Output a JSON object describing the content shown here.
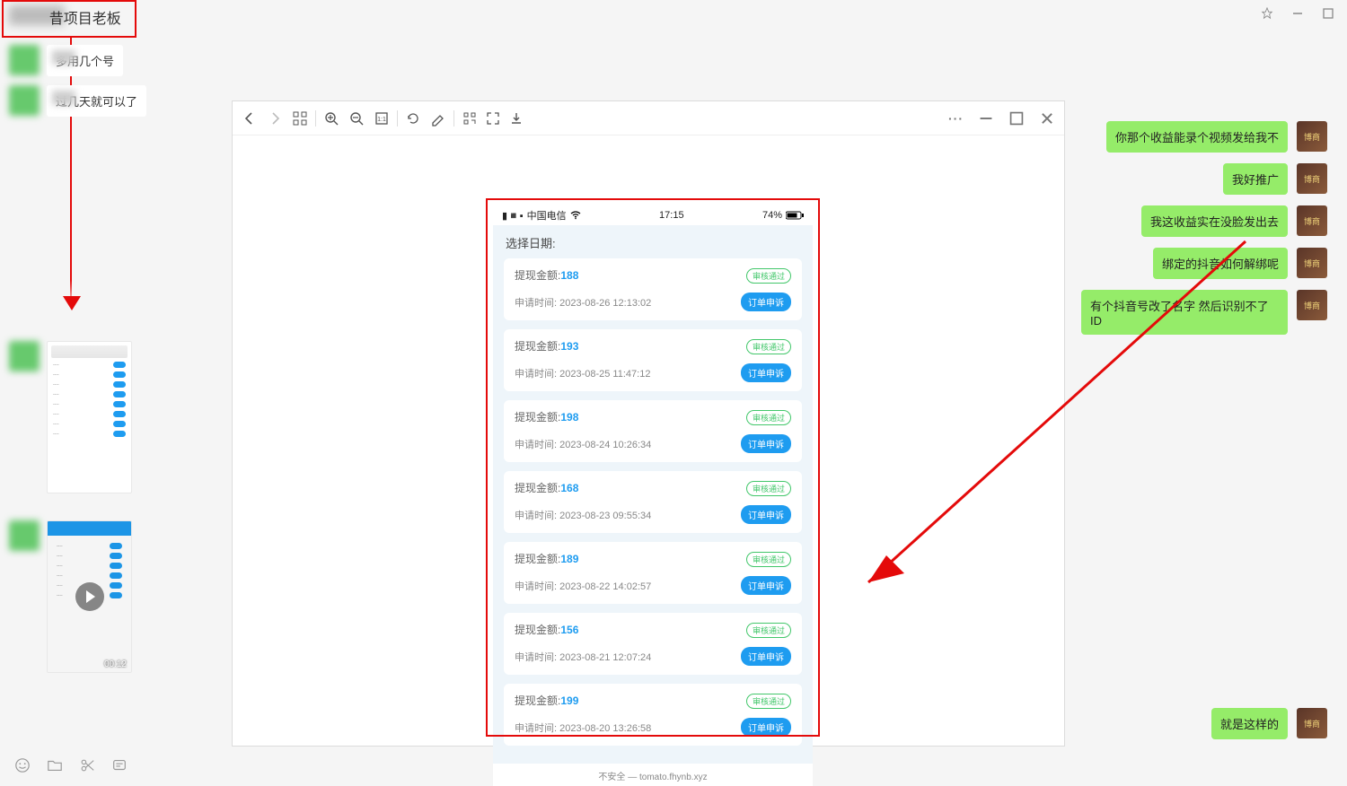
{
  "window": {
    "title_suffix": "昔项目老板",
    "pin_icon": "pin",
    "minimize_icon": "minimize",
    "maximize_icon": "maximize"
  },
  "left_messages": [
    {
      "text": "多用几个号"
    },
    {
      "text": "过几天就可以了"
    }
  ],
  "video_duration": "00:12",
  "right_messages": [
    "你那个收益能录个视频发给我不",
    "我好推广",
    "我这收益实在没脸发出去",
    "绑定的抖音如何解绑呢",
    "有个抖音号改了名字 然后识别不了ID"
  ],
  "right_bottom_message": "就是这样的",
  "viewer": {
    "more": "···"
  },
  "phone": {
    "carrier": "中国电信",
    "time": "17:15",
    "battery": "74%",
    "section_title": "选择日期:",
    "amount_label": "提现金额:",
    "apply_label_prefix": "申请时间: ",
    "status_text": "审核通过",
    "action_text": "订单申诉",
    "footer_text": "不安全 — tomato.fhynb.xyz",
    "records": [
      {
        "amount": "188",
        "time": "2023-08-26 12:13:02"
      },
      {
        "amount": "193",
        "time": "2023-08-25 11:47:12"
      },
      {
        "amount": "198",
        "time": "2023-08-24 10:26:34"
      },
      {
        "amount": "168",
        "time": "2023-08-23 09:55:34"
      },
      {
        "amount": "189",
        "time": "2023-08-22 14:02:57"
      },
      {
        "amount": "156",
        "time": "2023-08-21 12:07:24"
      },
      {
        "amount": "199",
        "time": "2023-08-20 13:26:58"
      }
    ]
  }
}
